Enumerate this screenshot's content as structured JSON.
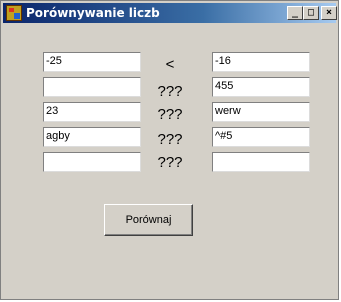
{
  "window": {
    "title": "Porównywanie liczb",
    "minimize_glyph": "_",
    "maximize_glyph": "□",
    "close_glyph": "×"
  },
  "rows": [
    {
      "left": "-25",
      "op": "<",
      "right": "-16"
    },
    {
      "left": "",
      "op": "???",
      "right": "455"
    },
    {
      "left": "23",
      "op": "???",
      "right": "werw"
    },
    {
      "left": "agby",
      "op": "???",
      "right": "^#5"
    },
    {
      "left": "",
      "op": "???",
      "right": ""
    }
  ],
  "compare_button": {
    "label": "Porównaj"
  }
}
